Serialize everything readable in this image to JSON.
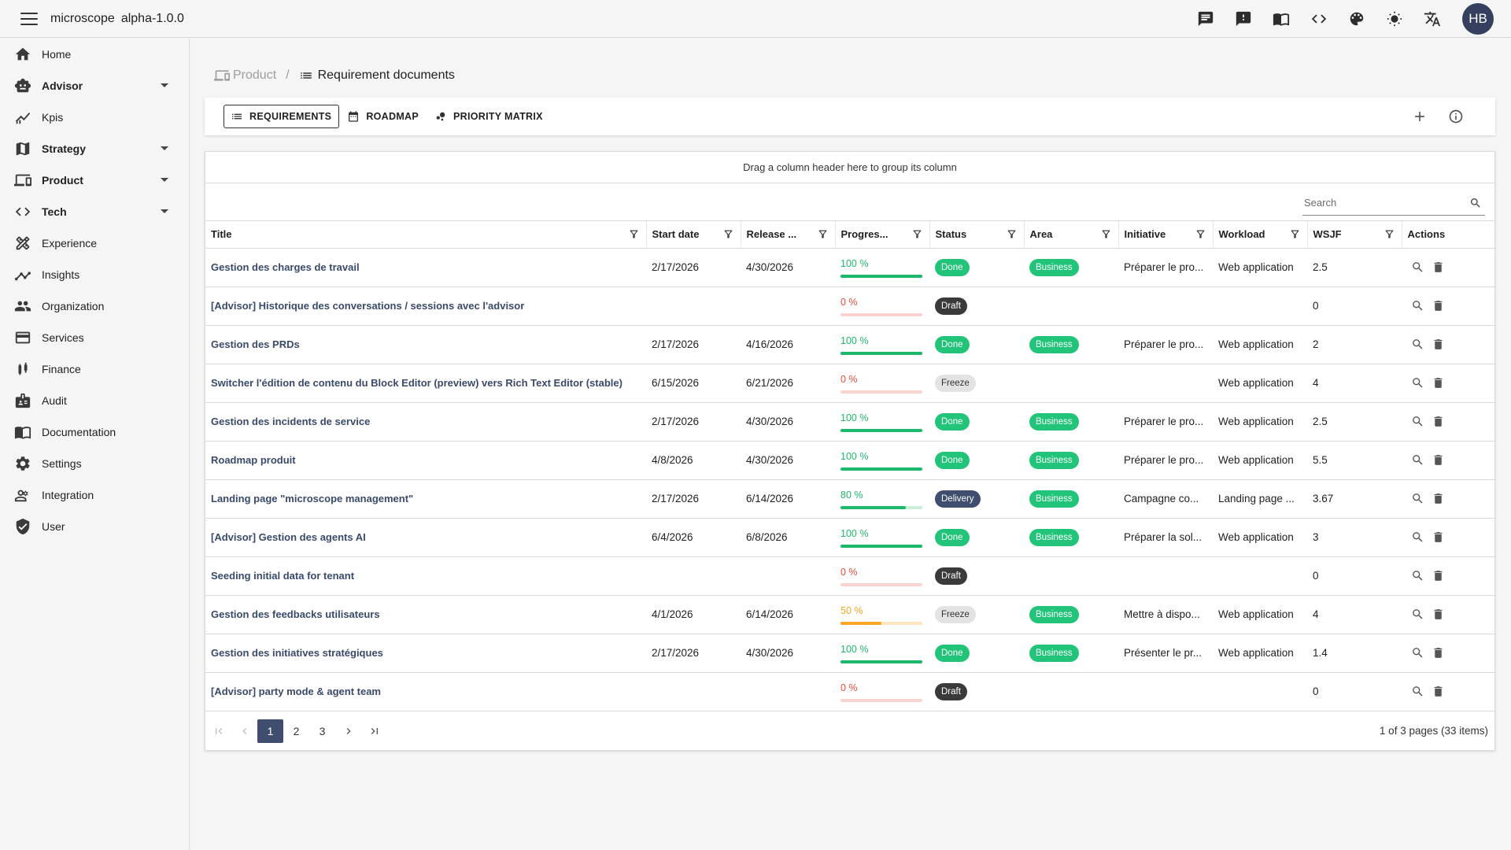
{
  "app": {
    "title": "microscope",
    "version": "alpha-1.0.0",
    "avatar_initials": "HB"
  },
  "topbar_icons": [
    "chat-icon",
    "feedback-icon",
    "docs-book-icon",
    "code-icon",
    "palette-icon",
    "brightness-icon",
    "translate-icon"
  ],
  "sidebar": {
    "items": [
      {
        "label": "Home",
        "icon": "home-icon",
        "bold": false,
        "expandable": false
      },
      {
        "label": "Advisor",
        "icon": "robot-icon",
        "bold": true,
        "expandable": true
      },
      {
        "label": "Kpis",
        "icon": "kpi-icon",
        "bold": false,
        "expandable": false
      },
      {
        "label": "Strategy",
        "icon": "map-icon",
        "bold": true,
        "expandable": true
      },
      {
        "label": "Product",
        "icon": "devices-icon",
        "bold": true,
        "expandable": true
      },
      {
        "label": "Tech",
        "icon": "code-icon",
        "bold": true,
        "expandable": true
      },
      {
        "label": "Experience",
        "icon": "design-icon",
        "bold": false,
        "expandable": false
      },
      {
        "label": "Insights",
        "icon": "insights-icon",
        "bold": false,
        "expandable": false
      },
      {
        "label": "Organization",
        "icon": "people-icon",
        "bold": false,
        "expandable": false
      },
      {
        "label": "Services",
        "icon": "card-icon",
        "bold": false,
        "expandable": false
      },
      {
        "label": "Finance",
        "icon": "finance-icon",
        "bold": false,
        "expandable": false
      },
      {
        "label": "Audit",
        "icon": "audit-icon",
        "bold": false,
        "expandable": false
      },
      {
        "label": "Documentation",
        "icon": "book-icon",
        "bold": false,
        "expandable": false
      },
      {
        "label": "Settings",
        "icon": "gear-icon",
        "bold": false,
        "expandable": false
      },
      {
        "label": "Integration",
        "icon": "integration-icon",
        "bold": false,
        "expandable": false
      },
      {
        "label": "User",
        "icon": "shield-user-icon",
        "bold": false,
        "expandable": false
      }
    ]
  },
  "breadcrumb": {
    "root": "Product",
    "separator": "/",
    "current": "Requirement documents"
  },
  "tabs": [
    {
      "label": "REQUIREMENTS",
      "active": true
    },
    {
      "label": "ROADMAP",
      "active": false
    },
    {
      "label": "PRIORITY MATRIX",
      "active": false
    }
  ],
  "grid": {
    "group_panel_text": "Drag a column header here to group its column",
    "search_placeholder": "Search",
    "columns": [
      "Title",
      "Start date",
      "Release ...",
      "Progres...",
      "Status",
      "Area",
      "Initiative",
      "Workload",
      "WSJF",
      "Actions"
    ],
    "rows": [
      {
        "title": "Gestion des charges de travail",
        "start": "2/17/2026",
        "release": "4/30/2026",
        "progress": "100 %",
        "progress_value": 1.0,
        "status": "Done",
        "area": "Business",
        "initiative": "Préparer le pro...",
        "workload": "Web application",
        "wsjf": "2.5"
      },
      {
        "title": "[Advisor] Historique des conversations / sessions avec l'advisor",
        "start": "",
        "release": "",
        "progress": "0 %",
        "progress_value": 0,
        "status": "Draft",
        "area": "",
        "initiative": "",
        "workload": "",
        "wsjf": "0"
      },
      {
        "title": "Gestion des PRDs",
        "start": "2/17/2026",
        "release": "4/16/2026",
        "progress": "100 %",
        "progress_value": 1.0,
        "status": "Done",
        "area": "Business",
        "initiative": "Préparer le pro...",
        "workload": "Web application",
        "wsjf": "2"
      },
      {
        "title": "Switcher l'édition de contenu du Block Editor (preview) vers Rich Text Editor (stable)",
        "start": "6/15/2026",
        "release": "6/21/2026",
        "progress": "0 %",
        "progress_value": 0,
        "status": "Freeze",
        "area": "",
        "initiative": "",
        "workload": "Web application",
        "wsjf": "4"
      },
      {
        "title": "Gestion des incidents de service",
        "start": "2/17/2026",
        "release": "4/30/2026",
        "progress": "100 %",
        "progress_value": 1.0,
        "status": "Done",
        "area": "Business",
        "initiative": "Préparer le pro...",
        "workload": "Web application",
        "wsjf": "2.5"
      },
      {
        "title": "Roadmap produit",
        "start": "4/8/2026",
        "release": "4/30/2026",
        "progress": "100 %",
        "progress_value": 1.0,
        "status": "Done",
        "area": "Business",
        "initiative": "Préparer le pro...",
        "workload": "Web application",
        "wsjf": "5.5"
      },
      {
        "title": "Landing page \"microscope management\"",
        "start": "2/17/2026",
        "release": "6/14/2026",
        "progress": "80 %",
        "progress_value": 0.8,
        "status": "Delivery",
        "area": "Business",
        "initiative": "Campagne co...",
        "workload": "Landing page ...",
        "wsjf": "3.67"
      },
      {
        "title": "[Advisor] Gestion des agents AI",
        "start": "6/4/2026",
        "release": "6/8/2026",
        "progress": "100 %",
        "progress_value": 1.0,
        "status": "Done",
        "area": "Business",
        "initiative": "Préparer la sol...",
        "workload": "Web application",
        "wsjf": "3"
      },
      {
        "title": "Seeding initial data for tenant",
        "start": "",
        "release": "",
        "progress": "0 %",
        "progress_value": 0,
        "status": "Draft",
        "area": "",
        "initiative": "",
        "workload": "",
        "wsjf": "0"
      },
      {
        "title": "Gestion des feedbacks utilisateurs",
        "start": "4/1/2026",
        "release": "6/14/2026",
        "progress": "50 %",
        "progress_value": 0.5,
        "status": "Freeze",
        "area": "Business",
        "initiative": "Mettre à dispo...",
        "workload": "Web application",
        "wsjf": "4"
      },
      {
        "title": "Gestion des initiatives stratégiques",
        "start": "2/17/2026",
        "release": "4/30/2026",
        "progress": "100 %",
        "progress_value": 1.0,
        "status": "Done",
        "area": "Business",
        "initiative": "Présenter le pr...",
        "workload": "Web application",
        "wsjf": "1.4"
      },
      {
        "title": "[Advisor] party mode & agent team",
        "start": "",
        "release": "",
        "progress": "0 %",
        "progress_value": 0,
        "status": "Draft",
        "area": "",
        "initiative": "",
        "workload": "",
        "wsjf": "0"
      }
    ],
    "pager": {
      "pages": [
        "1",
        "2",
        "3"
      ],
      "current": "1",
      "info": "1 of 3 pages (33 items)"
    }
  },
  "colors": {
    "progress_full": "#1db96b",
    "progress_partial_high": "#1db96b",
    "progress_mid": "#f5a623",
    "progress_zero": "#e74c3c",
    "status_done": "#22c47a",
    "status_draft": "#3a3a3a",
    "status_freeze": "#e3e3e3",
    "status_delivery": "#3f4d6e",
    "area_business": "#22c47a"
  }
}
